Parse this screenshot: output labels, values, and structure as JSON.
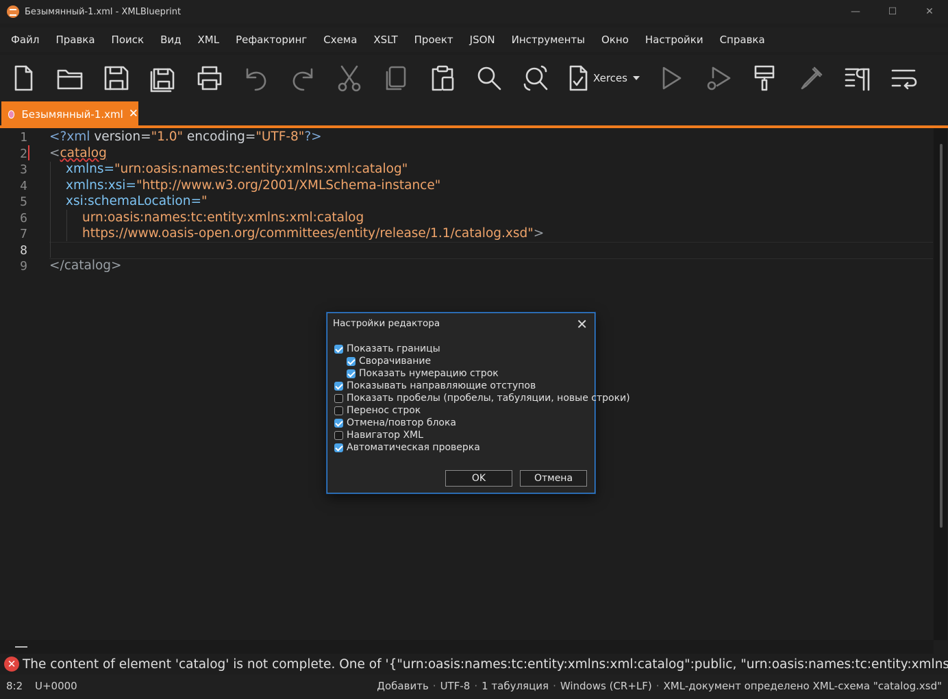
{
  "window": {
    "title": "Безымянный-1.xml - XMLBlueprint",
    "minimize": "—",
    "maximize": "☐",
    "close": "✕"
  },
  "menu": [
    "Файл",
    "Правка",
    "Поиск",
    "Вид",
    "XML",
    "Рефакторинг",
    "Схема",
    "XSLT",
    "Проект",
    "JSON",
    "Инструменты",
    "Окно",
    "Настройки",
    "Справка"
  ],
  "toolbar": {
    "icons": [
      "new-file-icon",
      "open-folder-icon",
      "save-icon",
      "save-all-icon",
      "print-icon",
      "undo-icon",
      "redo-icon",
      "cut-icon",
      "copy-icon",
      "paste-icon",
      "search-icon",
      "replace-icon",
      "validate-icon",
      "run-icon",
      "debug-icon",
      "format-icon",
      "eyedropper-icon",
      "pilcrow-icon",
      "wrap-icon"
    ],
    "validator": "Xerces"
  },
  "tab": {
    "label": "Безымянный-1.xml",
    "close": "✕"
  },
  "editor": {
    "line_numbers": [
      "1",
      "2",
      "3",
      "4",
      "5",
      "6",
      "7",
      "8",
      "9"
    ],
    "current_line": 8,
    "lines": [
      {
        "text1": "<?xml ",
        "text2": "version=",
        "text3": "\"1.0\" ",
        "text4": "encoding=",
        "text5": "\"UTF-8\"",
        "text6": "?>"
      },
      {
        "text1": "<",
        "text2": "catalog"
      },
      {
        "text1": "xmlns=",
        "text2": "\"urn:oasis:names:tc:entity:xmlns:xml:catalog\""
      },
      {
        "text1": "xmlns:xsi=",
        "text2": "\"http://www.w3.org/2001/XMLSchema-instance\""
      },
      {
        "text1": "xsi:schemaLocation=",
        "text2": "\""
      },
      {
        "text1": "urn:oasis:names:tc:entity:xmlns:xml:catalog"
      },
      {
        "text1": "https://www.oasis-open.org/committees/entity/release/1.1/catalog.xsd\"",
        "text2": ">"
      },
      {
        "text1": ""
      },
      {
        "text1": "</catalog>"
      }
    ]
  },
  "error": {
    "icon": "✕",
    "message": "The content of element 'catalog' is not complete. One of '{\"urn:oasis:names:tc:entity:xmlns:xml:catalog\":public, \"urn:oasis:names:tc:entity:xmlns:"
  },
  "status": {
    "position": "8:2",
    "unicode": "U+0000",
    "mode": "Добавить",
    "encoding": "UTF-8",
    "indent": "1 табуляция",
    "line_endings": "Windows (CR+LF)",
    "schema": "XML-документ определено XML-схема \"catalog.xsd\"",
    "sep": "·"
  },
  "dialog": {
    "title": "Настройки редактора",
    "close": "✕",
    "options": [
      {
        "label": "Показать границы",
        "checked": true,
        "indent": 0
      },
      {
        "label": "Сворачивание",
        "checked": true,
        "indent": 1
      },
      {
        "label": "Показать нумерацию строк",
        "checked": true,
        "indent": 1
      },
      {
        "label": "Показывать направляющие отступов",
        "checked": true,
        "indent": 0
      },
      {
        "label": "Показать пробелы (пробелы, табуляции, новые строки)",
        "checked": false,
        "indent": 0
      },
      {
        "label": "Перенос строк",
        "checked": false,
        "indent": 0
      },
      {
        "label": "Отмена/повтор блока",
        "checked": true,
        "indent": 0
      },
      {
        "label": "Навигатор XML",
        "checked": false,
        "indent": 0
      },
      {
        "label": "Автоматическая проверка",
        "checked": true,
        "indent": 0
      }
    ],
    "ok": "OK",
    "cancel": "Отмена"
  },
  "colors": {
    "accent": "#f07c1e",
    "dialog_border": "#3a86d8",
    "checkbox": "#4aa3e8",
    "error": "#e0443e"
  }
}
